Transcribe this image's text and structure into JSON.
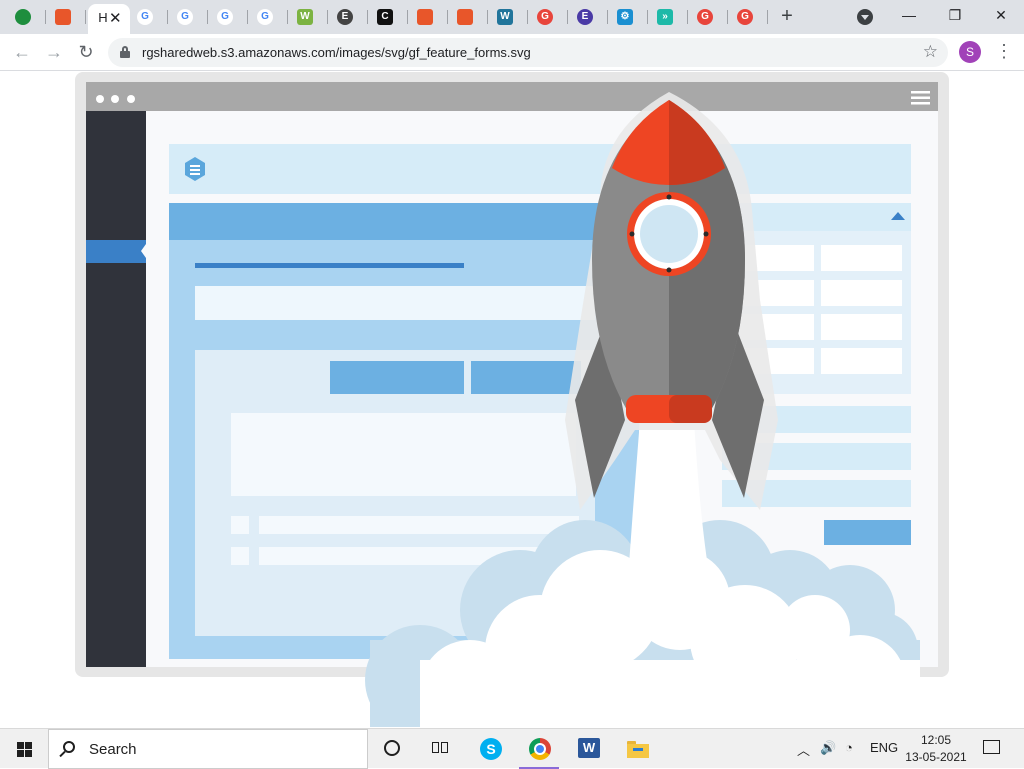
{
  "browser": {
    "tabs": [
      {
        "icon": "green-circle-icon",
        "color": "#1e8e3e",
        "glyph": ""
      },
      {
        "icon": "orange-square-icon",
        "color": "#e8562a",
        "glyph": ""
      },
      {
        "icon": "page-icon",
        "color": "#ffffff",
        "glyph": "H",
        "active": true
      },
      {
        "icon": "google-icon",
        "color": "#4285f4",
        "glyph": "G"
      },
      {
        "icon": "google-icon",
        "color": "#4285f4",
        "glyph": "G"
      },
      {
        "icon": "google-icon",
        "color": "#4285f4",
        "glyph": "G"
      },
      {
        "icon": "google-icon",
        "color": "#4285f4",
        "glyph": "G"
      },
      {
        "icon": "w-icon",
        "color": "#7cb342",
        "glyph": "W"
      },
      {
        "icon": "circle-e-icon",
        "color": "#444444",
        "glyph": "E"
      },
      {
        "icon": "c-icon",
        "color": "#111111",
        "glyph": "C"
      },
      {
        "icon": "orange-square-icon",
        "color": "#e8562a",
        "glyph": ""
      },
      {
        "icon": "megaphone-icon",
        "color": "#e8562a",
        "glyph": ""
      },
      {
        "icon": "wordpress-icon",
        "color": "#21759b",
        "glyph": "W"
      },
      {
        "icon": "g-red-icon",
        "color": "#e8453c",
        "glyph": "G"
      },
      {
        "icon": "purple-circle-icon",
        "color": "#4a3aa6",
        "glyph": "E"
      },
      {
        "icon": "gear-box-icon",
        "color": "#1a8fd1",
        "glyph": "⚙"
      },
      {
        "icon": "arrows-icon",
        "color": "#1db9a8",
        "glyph": "»"
      },
      {
        "icon": "g-red-icon",
        "color": "#e8453c",
        "glyph": "G"
      },
      {
        "icon": "g-red-icon",
        "color": "#e8453c",
        "glyph": "G"
      }
    ],
    "new_tab": "+",
    "url": "rgsharedweb.s3.amazonaws.com/images/svg/gf_feature_forms.svg",
    "profile_initial": "S",
    "window": {
      "minimize": "—",
      "restore": "❐",
      "close": "✕"
    }
  },
  "nav": {
    "back": "←",
    "forward": "→",
    "reload": "↻",
    "star": "☆",
    "menu": "⋮"
  },
  "taskbar": {
    "search_placeholder": "Search",
    "apps": [
      {
        "name": "cortana-icon"
      },
      {
        "name": "task-view-icon"
      },
      {
        "name": "skype-icon",
        "glyph": "S"
      },
      {
        "name": "chrome-icon",
        "active": true
      },
      {
        "name": "word-icon",
        "glyph": "W"
      },
      {
        "name": "file-explorer-icon"
      }
    ],
    "tray": {
      "language": "ENG"
    },
    "clock": {
      "time": "12:05",
      "date": "13-05-2021"
    }
  },
  "colors": {
    "sidebar": "#30333b",
    "frame": "#e6e6e6",
    "light_blue": "#d6ecf8",
    "mid_blue": "#6cb0e2",
    "rocket_red": "#ee4523",
    "rocket_grey": "#7a7a7a"
  }
}
